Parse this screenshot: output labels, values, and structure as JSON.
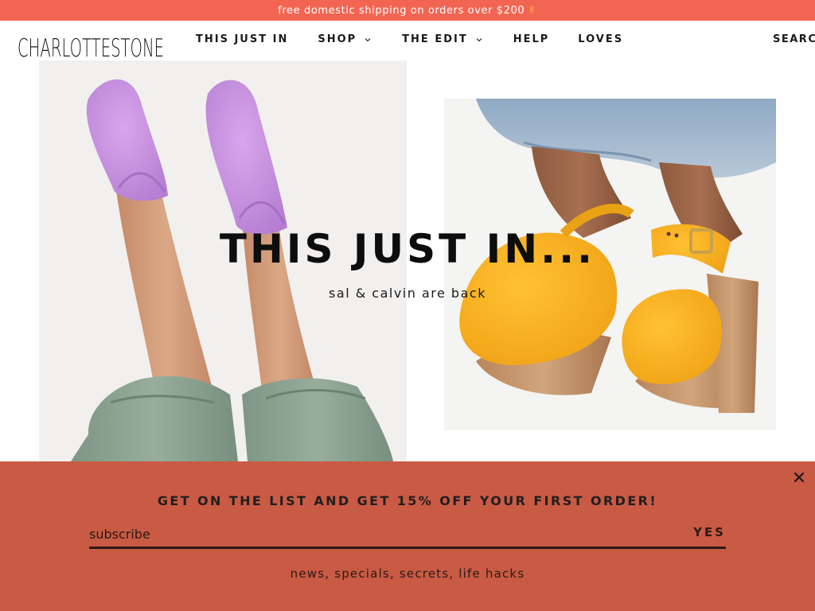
{
  "announcement": {
    "text": "free domestic shipping on orders over $200",
    "emoji": "✌"
  },
  "brand": {
    "logo_text": "CHARLOTTESTONE",
    "logo_parts": [
      "CHARL",
      "O",
      "T",
      "T",
      "ESTONE"
    ]
  },
  "nav": {
    "items": [
      {
        "label": "THIS JUST IN",
        "has_dropdown": false
      },
      {
        "label": "SHOP",
        "has_dropdown": true
      },
      {
        "label": "THE EDIT",
        "has_dropdown": true
      },
      {
        "label": "HELP",
        "has_dropdown": false
      },
      {
        "label": "LOVES",
        "has_dropdown": false
      }
    ],
    "search_label": "SEARCH"
  },
  "hero": {
    "title": "THIS JUST IN...",
    "subtitle": "sal & calvin are back"
  },
  "popup": {
    "heading": "GET ON THE LIST AND GET 15% OFF YOUR FIRST ORDER!",
    "input_placeholder": "subscribe",
    "submit_label": "YES",
    "tagline": "news, specials, secrets, life hacks"
  },
  "colors": {
    "announcement_bg": "#f26552",
    "popup_bg": "#c95a44",
    "text_dark": "#1a1a1a"
  }
}
